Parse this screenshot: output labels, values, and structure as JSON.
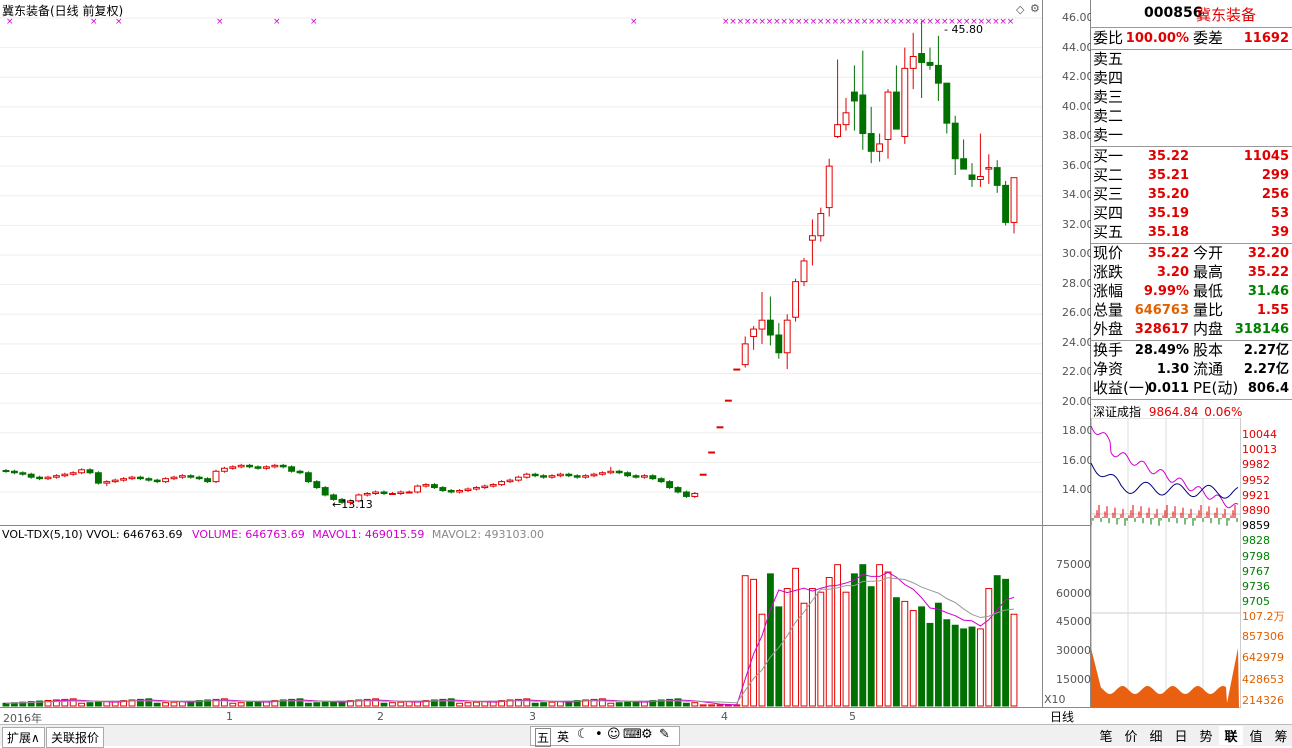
{
  "chart_title": "冀东装备(日线 前复权)",
  "price_high_label": "45.80",
  "price_low_label": "13.13",
  "price_axis": [
    "46.00",
    "44.00",
    "42.00",
    "40.00",
    "38.00",
    "36.00",
    "34.00",
    "32.00",
    "30.00",
    "28.00",
    "26.00",
    "24.00",
    "22.00",
    "20.00",
    "18.00",
    "16.00",
    "14.00"
  ],
  "vol_header": {
    "name": "VOL-TDX(5,10)",
    "vvol": "VVOL: 646763.69",
    "volume": "VOLUME: 646763.69",
    "mavol1": "MAVOL1: 469015.59",
    "mavol2": "MAVOL2: 493103.00"
  },
  "vol_axis": [
    "75000",
    "60000",
    "45000",
    "30000",
    "15000"
  ],
  "vol_unit": "X10",
  "date_labels": [
    "2016年",
    "1",
    "2",
    "3",
    "4",
    "5"
  ],
  "period_label": "日线",
  "bottom_tabs": [
    "扩展∧",
    "关联报价"
  ],
  "toolbar_icons": [
    "五",
    "英"
  ],
  "right_tabs": [
    "笔",
    "价",
    "细",
    "日",
    "势",
    "联",
    "值",
    "筹"
  ],
  "quote": {
    "code": "000856",
    "name": "冀东装备",
    "weibi_label": "委比",
    "weibi": "100.00%",
    "weicha_label": "委差",
    "weicha": "11692",
    "sells": [
      "卖五",
      "卖四",
      "卖三",
      "卖二",
      "卖一"
    ],
    "buys": [
      {
        "label": "买一",
        "price": "35.22",
        "vol": "11045"
      },
      {
        "label": "买二",
        "price": "35.21",
        "vol": "299"
      },
      {
        "label": "买三",
        "price": "35.20",
        "vol": "256"
      },
      {
        "label": "买四",
        "price": "35.19",
        "vol": "53"
      },
      {
        "label": "买五",
        "price": "35.18",
        "vol": "39"
      }
    ],
    "stats": [
      {
        "l1": "现价",
        "v1": "35.22",
        "l2": "今开",
        "v2": "32.20"
      },
      {
        "l1": "涨跌",
        "v1": "3.20",
        "l2": "最高",
        "v2": "35.22"
      },
      {
        "l1": "涨幅",
        "v1": "9.99%",
        "l2": "最低",
        "v2": "31.46"
      },
      {
        "l1": "总量",
        "v1": "646763",
        "l2": "量比",
        "v2": "1.55"
      },
      {
        "l1": "外盘",
        "v1": "328617",
        "l2": "内盘",
        "v2": "318146"
      }
    ],
    "fund": [
      {
        "l1": "换手",
        "v1": "28.49%",
        "l2": "股本",
        "v2": "2.27亿"
      },
      {
        "l1": "净资",
        "v1": "1.30",
        "l2": "流通",
        "v2": "2.27亿"
      },
      {
        "l1": "收益(一)",
        "v1": "0.011",
        "l2": "PE(动)",
        "v2": "806.4"
      }
    ]
  },
  "index": {
    "name": "深证成指",
    "value": "9864.84",
    "pct": "0.06%",
    "axis_up": [
      "10044",
      "10013",
      "9982",
      "9952",
      "9921",
      "9890"
    ],
    "axis_mid": "9859",
    "axis_down": [
      "9828",
      "9798",
      "9767",
      "9736",
      "9705"
    ],
    "vol_axis": [
      "107.2万",
      "857306",
      "642979",
      "428653",
      "214326"
    ]
  },
  "chart_data": {
    "type": "candlestick",
    "title": "冀东装备(日线 前复权)",
    "ylim": [
      13,
      46.5
    ],
    "candles_note": "2016 daily",
    "ohlc": [
      [
        15.45,
        15.55,
        15.3,
        15.4
      ],
      [
        15.4,
        15.5,
        15.2,
        15.3
      ],
      [
        15.3,
        15.4,
        15.1,
        15.2
      ],
      [
        15.2,
        15.3,
        14.9,
        15.0
      ],
      [
        15.0,
        15.1,
        14.8,
        14.9
      ],
      [
        14.9,
        15.1,
        14.8,
        15.0
      ],
      [
        15.0,
        15.2,
        14.9,
        15.1
      ],
      [
        15.1,
        15.3,
        15.0,
        15.2
      ],
      [
        15.2,
        15.4,
        15.1,
        15.3
      ],
      [
        15.3,
        15.6,
        15.2,
        15.5
      ],
      [
        15.5,
        15.6,
        15.2,
        15.3
      ],
      [
        15.3,
        15.4,
        14.5,
        14.6
      ],
      [
        14.6,
        14.8,
        14.4,
        14.7
      ],
      [
        14.7,
        14.9,
        14.6,
        14.8
      ],
      [
        14.8,
        15.0,
        14.7,
        14.9
      ],
      [
        14.9,
        15.1,
        14.8,
        15.0
      ],
      [
        15.0,
        15.1,
        14.8,
        14.9
      ],
      [
        14.9,
        15.0,
        14.7,
        14.8
      ],
      [
        14.8,
        14.9,
        14.6,
        14.7
      ],
      [
        14.7,
        15.0,
        14.6,
        14.9
      ],
      [
        14.9,
        15.1,
        14.8,
        15.0
      ],
      [
        15.0,
        15.2,
        14.9,
        15.1
      ],
      [
        15.1,
        15.2,
        14.9,
        15.0
      ],
      [
        15.0,
        15.1,
        14.8,
        14.9
      ],
      [
        14.9,
        15.0,
        14.6,
        14.7
      ],
      [
        14.7,
        15.5,
        14.6,
        15.4
      ],
      [
        15.4,
        15.7,
        15.3,
        15.6
      ],
      [
        15.6,
        15.8,
        15.5,
        15.7
      ],
      [
        15.7,
        15.9,
        15.6,
        15.8
      ],
      [
        15.8,
        15.9,
        15.6,
        15.7
      ],
      [
        15.7,
        15.8,
        15.5,
        15.6
      ],
      [
        15.6,
        15.8,
        15.5,
        15.7
      ],
      [
        15.7,
        15.9,
        15.6,
        15.8
      ],
      [
        15.8,
        15.9,
        15.6,
        15.7
      ],
      [
        15.7,
        15.8,
        15.3,
        15.4
      ],
      [
        15.4,
        15.5,
        15.2,
        15.3
      ],
      [
        15.3,
        15.4,
        14.6,
        14.7
      ],
      [
        14.7,
        14.8,
        14.2,
        14.3
      ],
      [
        14.3,
        14.4,
        13.7,
        13.8
      ],
      [
        13.8,
        13.9,
        13.4,
        13.5
      ],
      [
        13.5,
        13.6,
        13.2,
        13.3
      ],
      [
        13.3,
        13.5,
        13.13,
        13.4
      ],
      [
        13.4,
        13.9,
        13.3,
        13.8
      ],
      [
        13.8,
        14.0,
        13.7,
        13.9
      ],
      [
        13.9,
        14.1,
        13.8,
        14.0
      ],
      [
        14.0,
        14.1,
        13.8,
        13.9
      ],
      [
        13.9,
        14.0,
        13.8,
        13.9
      ],
      [
        13.9,
        14.1,
        13.8,
        14.0
      ],
      [
        14.0,
        14.1,
        13.9,
        14.0
      ],
      [
        14.0,
        14.5,
        13.9,
        14.4
      ],
      [
        14.4,
        14.6,
        14.3,
        14.5
      ],
      [
        14.5,
        14.6,
        14.2,
        14.3
      ],
      [
        14.3,
        14.4,
        14.0,
        14.1
      ],
      [
        14.1,
        14.2,
        13.9,
        14.0
      ],
      [
        14.0,
        14.2,
        13.9,
        14.1
      ],
      [
        14.1,
        14.3,
        14.0,
        14.2
      ],
      [
        14.2,
        14.4,
        14.1,
        14.3
      ],
      [
        14.3,
        14.5,
        14.2,
        14.4
      ],
      [
        14.4,
        14.6,
        14.3,
        14.5
      ],
      [
        14.5,
        14.8,
        14.4,
        14.7
      ],
      [
        14.7,
        14.9,
        14.6,
        14.8
      ],
      [
        14.8,
        15.1,
        14.7,
        15.0
      ],
      [
        15.0,
        15.3,
        14.9,
        15.2
      ],
      [
        15.2,
        15.3,
        15.0,
        15.1
      ],
      [
        15.1,
        15.2,
        14.9,
        15.0
      ],
      [
        15.0,
        15.2,
        14.9,
        15.1
      ],
      [
        15.1,
        15.3,
        15.0,
        15.2
      ],
      [
        15.2,
        15.3,
        15.0,
        15.1
      ],
      [
        15.1,
        15.2,
        14.9,
        15.0
      ],
      [
        15.0,
        15.2,
        14.9,
        15.1
      ],
      [
        15.1,
        15.3,
        15.0,
        15.2
      ],
      [
        15.2,
        15.4,
        15.1,
        15.3
      ],
      [
        15.3,
        15.7,
        15.2,
        15.4
      ],
      [
        15.4,
        15.5,
        15.2,
        15.3
      ],
      [
        15.3,
        15.4,
        15.0,
        15.1
      ],
      [
        15.1,
        15.2,
        14.9,
        15.0
      ],
      [
        15.0,
        15.2,
        14.9,
        15.1
      ],
      [
        15.1,
        15.2,
        14.8,
        14.9
      ],
      [
        14.9,
        15.0,
        14.6,
        14.7
      ],
      [
        14.7,
        14.8,
        14.2,
        14.3
      ],
      [
        14.3,
        14.4,
        13.9,
        14.0
      ],
      [
        14.0,
        14.1,
        13.6,
        13.7
      ],
      [
        13.7,
        14.0,
        13.6,
        13.9
      ],
      [
        15.2,
        15.2,
        15.2,
        15.2
      ],
      [
        16.7,
        16.7,
        16.7,
        16.7
      ],
      [
        18.4,
        18.4,
        18.4,
        18.4
      ],
      [
        20.2,
        20.2,
        20.2,
        20.2
      ],
      [
        22.3,
        22.3,
        22.3,
        22.3
      ],
      [
        22.6,
        24.5,
        22.4,
        24.0
      ],
      [
        24.5,
        25.2,
        23.6,
        25.0
      ],
      [
        25.0,
        27.5,
        24.0,
        25.6
      ],
      [
        25.6,
        27.2,
        23.9,
        24.6
      ],
      [
        24.6,
        25.4,
        23.0,
        23.4
      ],
      [
        23.4,
        26.0,
        22.3,
        25.6
      ],
      [
        25.8,
        28.4,
        25.5,
        28.2
      ],
      [
        28.2,
        29.8,
        27.9,
        29.6
      ],
      [
        31.0,
        32.4,
        29.3,
        31.3
      ],
      [
        31.3,
        33.2,
        30.9,
        32.8
      ],
      [
        33.2,
        36.5,
        32.6,
        36.0
      ],
      [
        38.0,
        43.2,
        37.9,
        38.8
      ],
      [
        38.8,
        40.6,
        38.4,
        39.6
      ],
      [
        41.0,
        42.8,
        38.4,
        40.4
      ],
      [
        40.8,
        43.8,
        37.1,
        38.2
      ],
      [
        38.2,
        40.0,
        36.2,
        37.0
      ],
      [
        37.0,
        38.2,
        36.3,
        37.5
      ],
      [
        37.8,
        41.2,
        36.5,
        41.0
      ],
      [
        41.0,
        42.8,
        38.8,
        38.5
      ],
      [
        38.0,
        44.0,
        37.5,
        42.6
      ],
      [
        42.6,
        45.0,
        41.2,
        43.4
      ],
      [
        43.6,
        45.8,
        40.6,
        43.0
      ],
      [
        43.0,
        44.0,
        42.5,
        42.8
      ],
      [
        42.8,
        44.8,
        40.4,
        41.6
      ],
      [
        41.6,
        41.6,
        38.2,
        38.9
      ],
      [
        38.9,
        39.4,
        35.4,
        36.5
      ],
      [
        36.5,
        37.8,
        35.8,
        35.8
      ],
      [
        35.4,
        36.2,
        34.6,
        35.1
      ],
      [
        35.1,
        38.2,
        34.6,
        35.3
      ],
      [
        35.8,
        36.8,
        34.8,
        35.9
      ],
      [
        35.9,
        36.4,
        34.2,
        34.7
      ],
      [
        34.7,
        35.0,
        32.0,
        32.2
      ],
      [
        32.2,
        35.22,
        31.46,
        35.22
      ]
    ]
  }
}
